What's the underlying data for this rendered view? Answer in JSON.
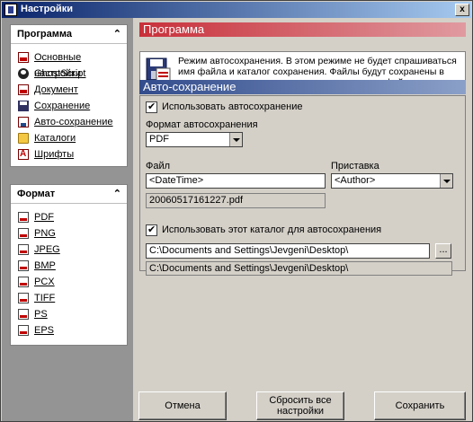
{
  "window": {
    "title": "Настройки",
    "close_label": "x"
  },
  "sidebar": {
    "program_panel": {
      "title": "Программа",
      "items": [
        {
          "label": "Основные настройки",
          "icon": "document-icon"
        },
        {
          "label": "GhostScript",
          "icon": "ghostscript-icon"
        },
        {
          "label": "Документ",
          "icon": "document-icon"
        },
        {
          "label": "Сохранение",
          "icon": "floppy-icon"
        },
        {
          "label": "Авто-сохранение",
          "icon": "autosave-icon"
        },
        {
          "label": "Каталоги",
          "icon": "folder-icon"
        },
        {
          "label": "Шрифты",
          "icon": "fonts-icon"
        }
      ]
    },
    "format_panel": {
      "title": "Формат",
      "items": [
        {
          "label": "PDF"
        },
        {
          "label": "PNG"
        },
        {
          "label": "JPEG"
        },
        {
          "label": "BMP"
        },
        {
          "label": "PCX"
        },
        {
          "label": "TIFF"
        },
        {
          "label": "PS"
        },
        {
          "label": "EPS"
        }
      ]
    }
  },
  "program_section": {
    "header": "Программа",
    "description": "Режим автосохранения. В этом режиме не будет спрашиваться имя файла и каталог сохранения. Файлы будут сохранены в одном каталоге с предустановленным именем файла."
  },
  "autosave_section": {
    "header": "Авто-сохранение",
    "use_autosave_label": "Использовать автосохранение",
    "format_label": "Формат автосохранения",
    "format_value": "PDF",
    "file_label": "Файл",
    "file_value": "<DateTime>",
    "prefix_label": "Приставка",
    "prefix_value": "<Author>",
    "file_preview": "20060517161227.pdf",
    "use_dir_label": "Использовать этот каталог для автосохранения",
    "dir_value": "C:\\Documents and Settings\\Jevgeni\\Desktop\\",
    "dir_preview": "C:\\Documents and Settings\\Jevgeni\\Desktop\\",
    "browse_label": "..."
  },
  "buttons": {
    "cancel": "Отмена",
    "reset_line1": "Сбросить все",
    "reset_line2": "настройки",
    "save": "Сохранить"
  },
  "colors": {
    "title_bar": "#0a246a",
    "program_header": "#c8303a",
    "autosave_header": "#324c8c"
  }
}
